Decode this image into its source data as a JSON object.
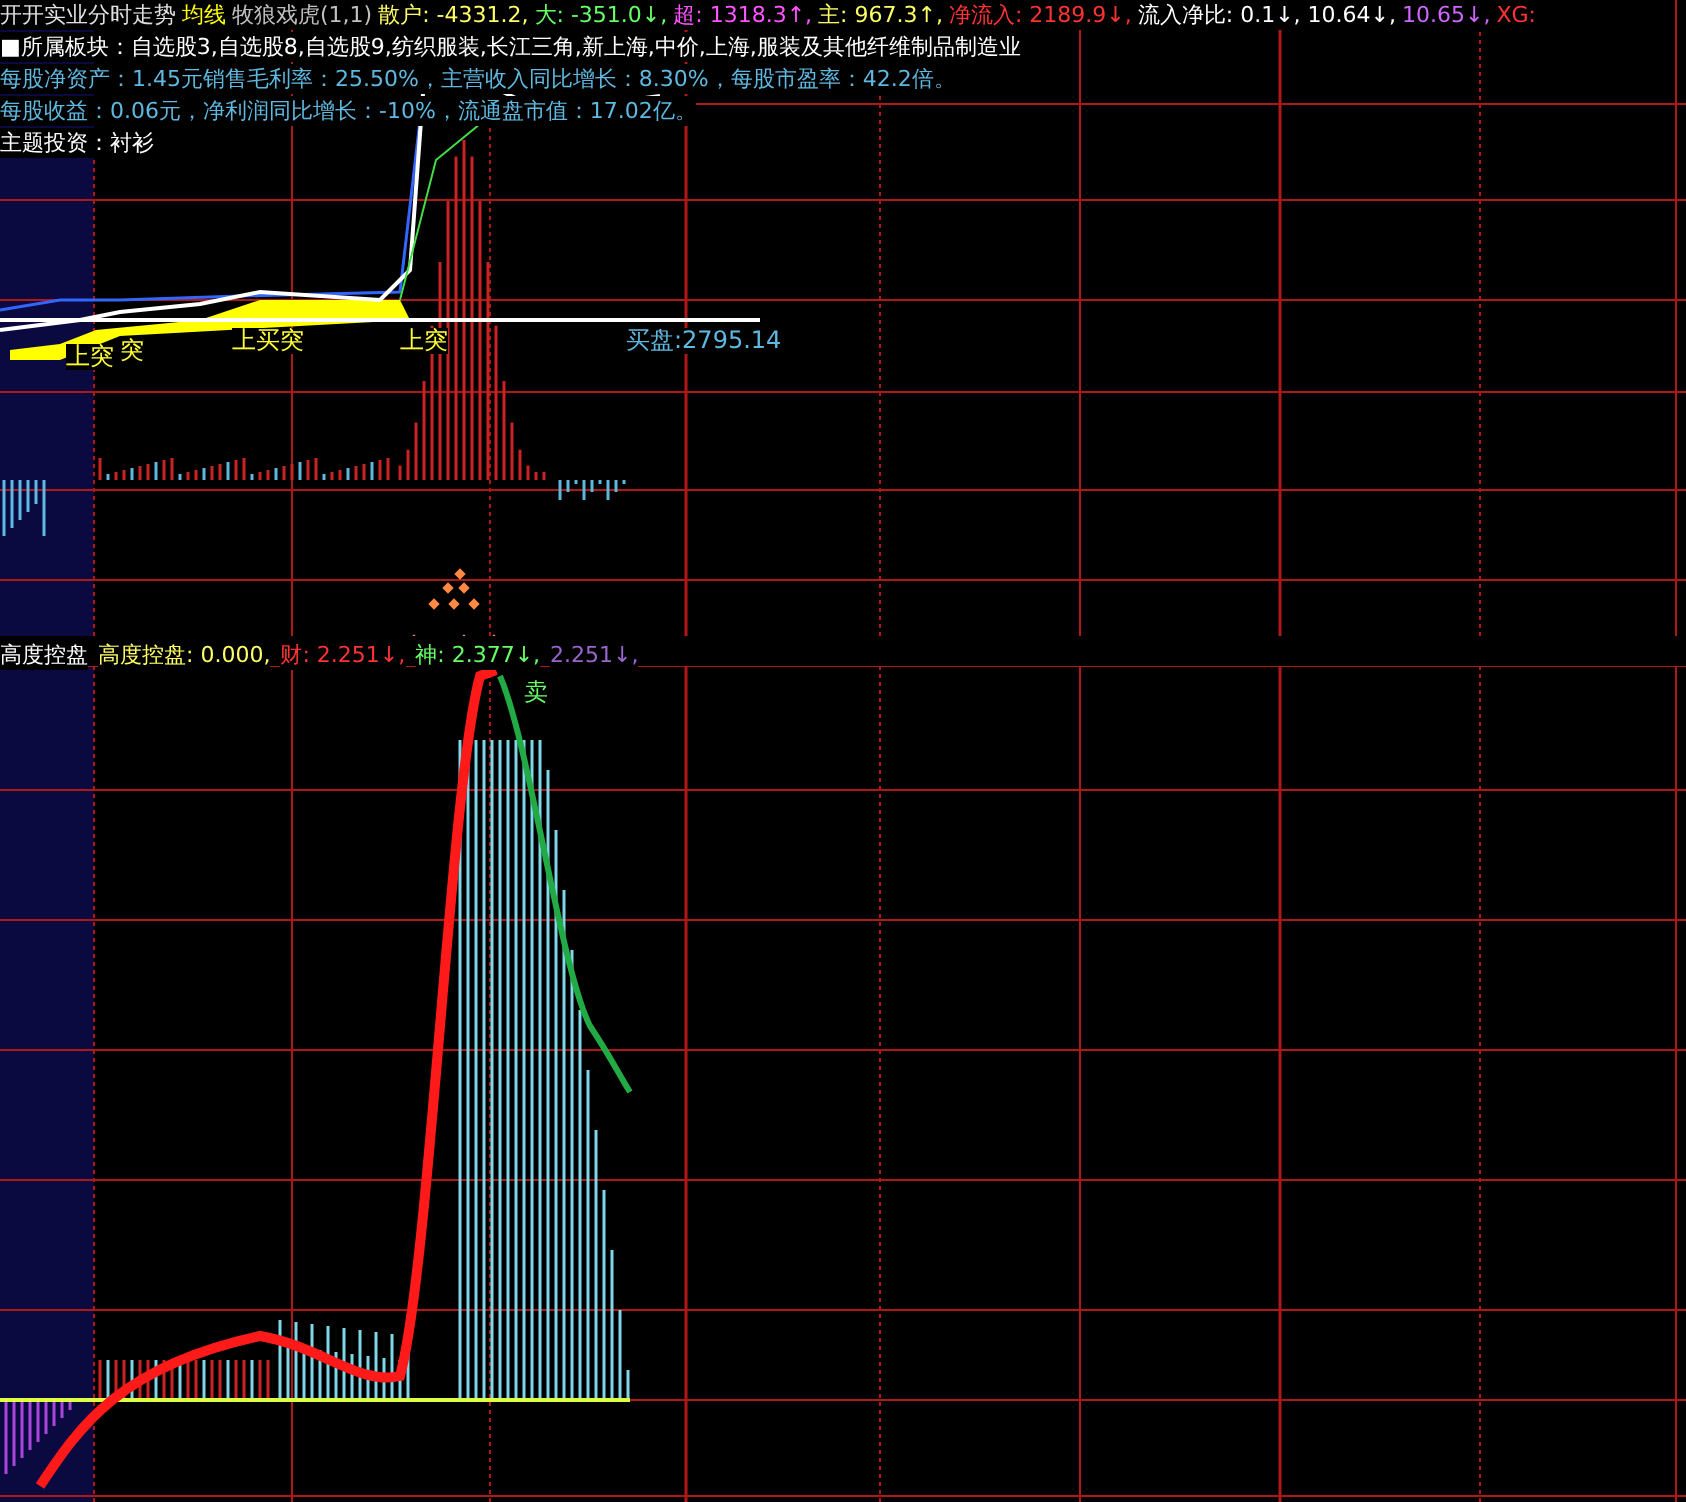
{
  "header": {
    "segments": [
      {
        "text": "开开实业分时走势",
        "color": "#e0e0e0"
      },
      {
        "text": "均线",
        "color": "#ffff00"
      },
      {
        "text": "牧狼戏虎(1,1)",
        "color": "#c0c0c0"
      },
      {
        "text": "散户: -4331.2,",
        "color": "#ffff66"
      },
      {
        "text": "大: -351.0↓,",
        "color": "#66ff66"
      },
      {
        "text": "超: 1318.3↑,",
        "color": "#ff55ff"
      },
      {
        "text": "主: 967.3↑,",
        "color": "#ffff66"
      },
      {
        "text": "净流入: 2189.9↓,",
        "color": "#ff3333"
      },
      {
        "text": "流入净比: 0.1↓, 10.64↓,",
        "color": "#ffffff"
      },
      {
        "text": "10.65↓,",
        "color": "#cc66ff"
      },
      {
        "text": "XG:",
        "color": "#ff3333"
      }
    ]
  },
  "info_lines": [
    {
      "text": "■所属板块：自选股3,自选股8,自选股9,纺织服装,长江三角,新上海,中价,上海,服装及其他纤维制品制造业",
      "kind": "sector"
    },
    {
      "text": "每股净资产：1.45元销售毛利率：25.50%，主营收入同比增长：8.30%，每股市盈率：42.2倍。",
      "kind": "finance"
    },
    {
      "text": "每股收益：0.06元，净利润同比增长：-10%，流通盘市值：17.02亿。",
      "kind": "finance"
    },
    {
      "text": "主题投资：衬衫",
      "kind": "theme"
    }
  ],
  "upper_chart": {
    "labels": [
      {
        "text": "上突"
      },
      {
        "text": "突"
      },
      {
        "text": "上买突"
      },
      {
        "text": "上突"
      },
      {
        "text": "买盘:2795.14"
      }
    ]
  },
  "lower_chart": {
    "title": "高度控盘",
    "segments": [
      {
        "text": "高度控盘: 0.000,",
        "color": "#ffff66"
      },
      {
        "text": "财: 2.251↓,",
        "color": "#ff3333"
      },
      {
        "text": "神: 2.377↓,",
        "color": "#66ff66"
      },
      {
        "text": "2.251↓,",
        "color": "#9966cc"
      }
    ],
    "labels": [
      {
        "text": "卖"
      }
    ]
  }
}
